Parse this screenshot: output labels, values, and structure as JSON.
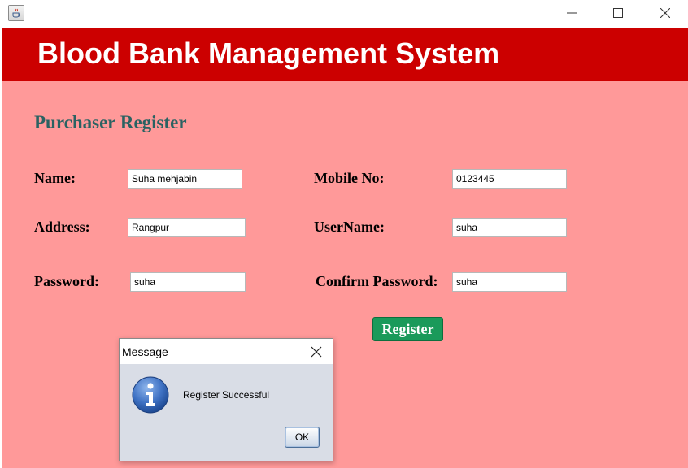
{
  "window": {
    "icon": "java-coffee-cup-icon",
    "controls": [
      "minimize-icon",
      "maximize-icon",
      "close-icon"
    ]
  },
  "header": {
    "title": "Blood Bank Management System",
    "background": "#cc0000"
  },
  "form": {
    "background": "#ff9999",
    "section_title": "Purchaser Register",
    "name_label": "Name:",
    "name_value": "Suha mehjabin",
    "mobile_label": "Mobile No:",
    "mobile_value": "0123445",
    "address_label": "Address:",
    "address_value": "Rangpur",
    "username_label": "UserName:",
    "username_value": "suha",
    "password_label": "Password:",
    "password_value": "suha",
    "confirm_password_label": "Confirm Password:",
    "confirm_password_value": "suha",
    "register_label": "Register",
    "register_color": "#1a9a5a"
  },
  "dialog": {
    "title": "Message",
    "icon": "info-icon",
    "message": "Register Successful",
    "ok_label": "OK"
  }
}
